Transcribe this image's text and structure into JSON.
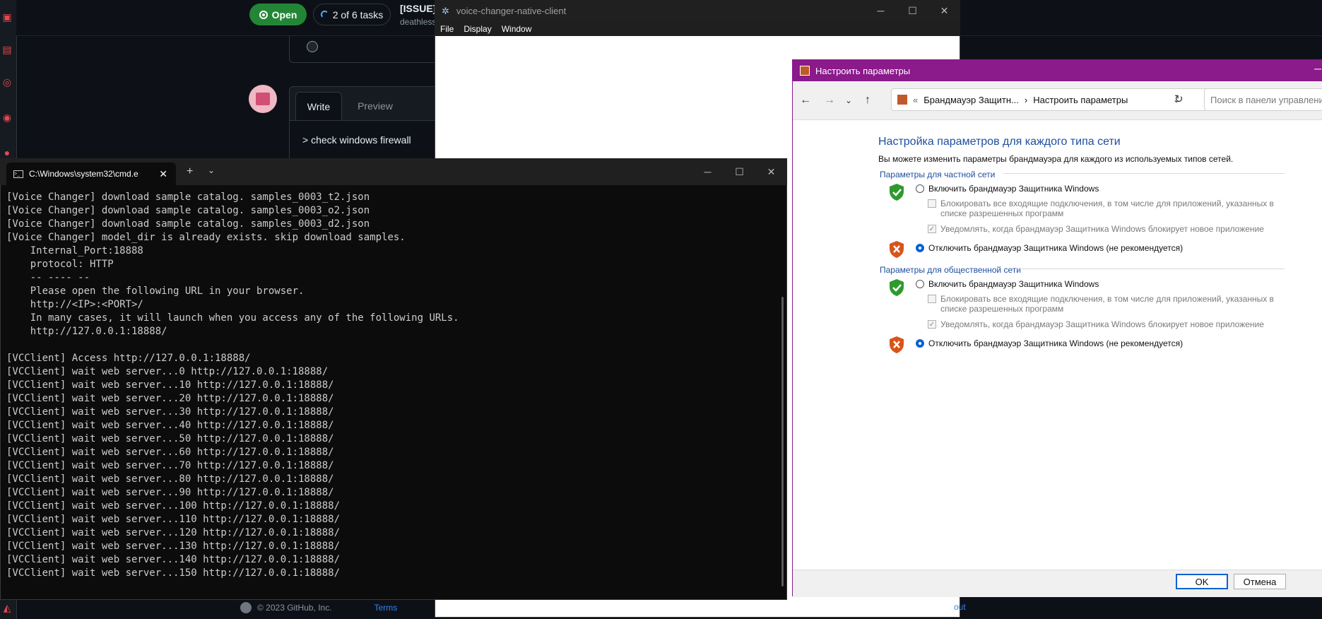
{
  "github": {
    "open_label": "Open",
    "tasks_label": "2 of 6 tasks",
    "issue_title": "[ISSUE]:",
    "issue_sub": "deathless",
    "write_tab": "Write",
    "preview_tab": "Preview",
    "editor_text": "> check windows firewall",
    "footer_copyright": "© 2023 GitHub, Inc.",
    "footer_terms": "Terms",
    "footer_frag": "out"
  },
  "electron": {
    "title": "voice-changer-native-client",
    "menu": [
      "File",
      "Display",
      "Window"
    ]
  },
  "terminal": {
    "tab_title": "C:\\Windows\\system32\\cmd.e",
    "lines": [
      "[Voice Changer] download sample catalog. samples_0003_t2.json",
      "[Voice Changer] download sample catalog. samples_0003_o2.json",
      "[Voice Changer] download sample catalog. samples_0003_d2.json",
      "[Voice Changer] model_dir is already exists. skip download samples.",
      "    Internal_Port:18888",
      "    protocol: HTTP",
      "    -- ---- --",
      "    Please open the following URL in your browser.",
      "    http://<IP>:<PORT>/",
      "    In many cases, it will launch when you access any of the following URLs.",
      "    http://127.0.0.1:18888/",
      "",
      "[VCClient] Access http://127.0.0.1:18888/",
      "[VCClient] wait web server...0 http://127.0.0.1:18888/",
      "[VCClient] wait web server...10 http://127.0.0.1:18888/",
      "[VCClient] wait web server...20 http://127.0.0.1:18888/",
      "[VCClient] wait web server...30 http://127.0.0.1:18888/",
      "[VCClient] wait web server...40 http://127.0.0.1:18888/",
      "[VCClient] wait web server...50 http://127.0.0.1:18888/",
      "[VCClient] wait web server...60 http://127.0.0.1:18888/",
      "[VCClient] wait web server...70 http://127.0.0.1:18888/",
      "[VCClient] wait web server...80 http://127.0.0.1:18888/",
      "[VCClient] wait web server...90 http://127.0.0.1:18888/",
      "[VCClient] wait web server...100 http://127.0.0.1:18888/",
      "[VCClient] wait web server...110 http://127.0.0.1:18888/",
      "[VCClient] wait web server...120 http://127.0.0.1:18888/",
      "[VCClient] wait web server...130 http://127.0.0.1:18888/",
      "[VCClient] wait web server...140 http://127.0.0.1:18888/",
      "[VCClient] wait web server...150 http://127.0.0.1:18888/"
    ]
  },
  "firewall": {
    "window_title": "Настроить параметры",
    "breadcrumb_sep": "«",
    "breadcrumb_1": "Брандмауэр Защитн...",
    "breadcrumb_arrow": "›",
    "breadcrumb_2": "Настроить параметры",
    "search_placeholder": "Поиск в панели управления",
    "heading": "Настройка параметров для каждого типа сети",
    "description": "Вы можете изменить параметры брандмауэра для каждого из используемых типов сетей.",
    "private_group": "Параметры для частной сети",
    "public_group": "Параметры для общественной сети",
    "enable_label": "Включить брандмауэр Защитника Windows",
    "block_label_1": "Блокировать все входящие подключения, в том числе для приложений, указанных в",
    "block_label_2": "списке разрешенных программ",
    "notify_label": "Уведомлять, когда брандмауэр Защитника Windows блокирует новое приложение",
    "disable_label": "Отключить брандмауэр Защитника Windows (не рекомендуется)",
    "private_enabled": false,
    "public_enabled": false,
    "ok_label": "OK",
    "cancel_label": "Отмена"
  },
  "colors": {
    "github_green": "#238636",
    "firewall_title": "#8b1a8b",
    "link_blue": "#1e4e9c"
  }
}
